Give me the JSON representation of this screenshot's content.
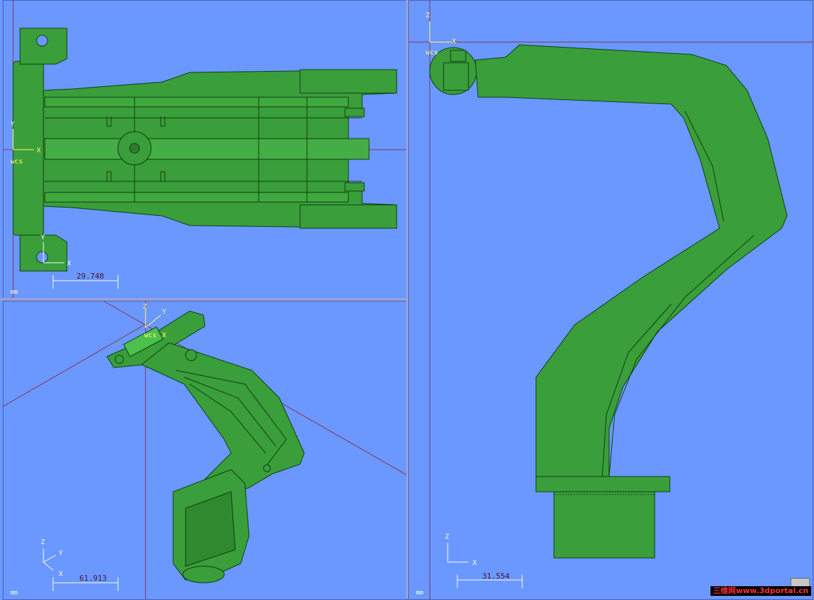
{
  "viewports": {
    "top": {
      "axis_x": "X",
      "axis_y": "Y",
      "wcs": "wcs",
      "axis_x2": "X",
      "axis_y2": "Y",
      "scale": "29.748",
      "units": "mm"
    },
    "iso": {
      "axis_z": "Z",
      "axis_y": "Y",
      "axis_x": "X",
      "wcs": "wcs",
      "tri_z": "Z",
      "tri_y": "Y",
      "tri_x": "X",
      "scale": "61.913",
      "units": "mm"
    },
    "side": {
      "axis_z": "Z",
      "axis_x": "X",
      "wcs": "wcs",
      "tri_z": "Z",
      "tri_x": "X",
      "scale": "31.554",
      "units": "mm"
    }
  },
  "colors": {
    "background": "#6a98ff",
    "part": "#3a9e3a",
    "edge": "#0d3d0d",
    "axis_line": "#8a3050",
    "label": "#ffff66"
  },
  "watermark": "三维网www.3dportal.cn"
}
